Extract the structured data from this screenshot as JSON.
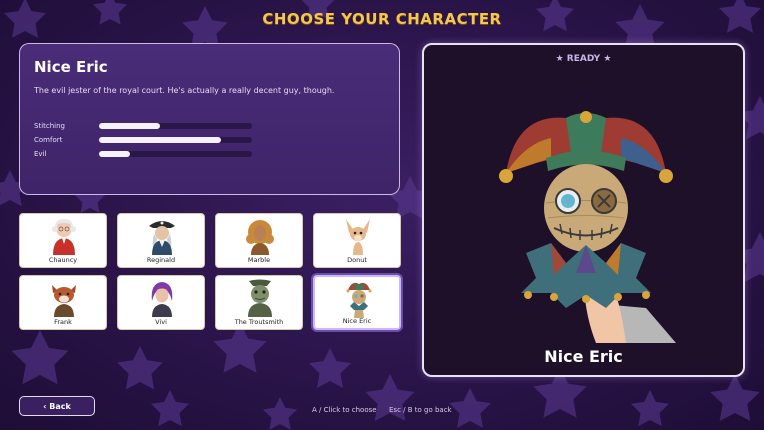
{
  "title": "CHOOSE YOUR CHARACTER",
  "selected": {
    "name": "Nice Eric",
    "description": "The evil jester of the royal court. He's actually a really decent guy, though.",
    "stats": [
      {
        "label": "Stitching",
        "value": 0.4
      },
      {
        "label": "Comfort",
        "value": 0.8
      },
      {
        "label": "Evil",
        "value": 0.2
      }
    ]
  },
  "characters": [
    {
      "name": "Chauncy",
      "icon": "grandma-portrait"
    },
    {
      "name": "Reginald",
      "icon": "pirate-portrait"
    },
    {
      "name": "Marble",
      "icon": "curly-hair-woman-portrait"
    },
    {
      "name": "Donut",
      "icon": "chihuahua-portrait"
    },
    {
      "name": "Frank",
      "icon": "red-panda-portrait"
    },
    {
      "name": "Vivi",
      "icon": "purple-hair-girl-portrait"
    },
    {
      "name": "The Troutsmith",
      "icon": "fish-man-portrait"
    },
    {
      "name": "Nice Eric",
      "icon": "jester-puppet-portrait"
    }
  ],
  "preview": {
    "status": "★ READY ★",
    "name": "Nice Eric"
  },
  "controls": {
    "back": "‹ Back",
    "choose_hint": "A / Click to choose",
    "back_hint": "Esc / B to go back"
  },
  "colors": {
    "title": "#f4c84a",
    "background": "#2a1449",
    "panel": "#4a2c78",
    "preview_bg": "#1d1028"
  }
}
